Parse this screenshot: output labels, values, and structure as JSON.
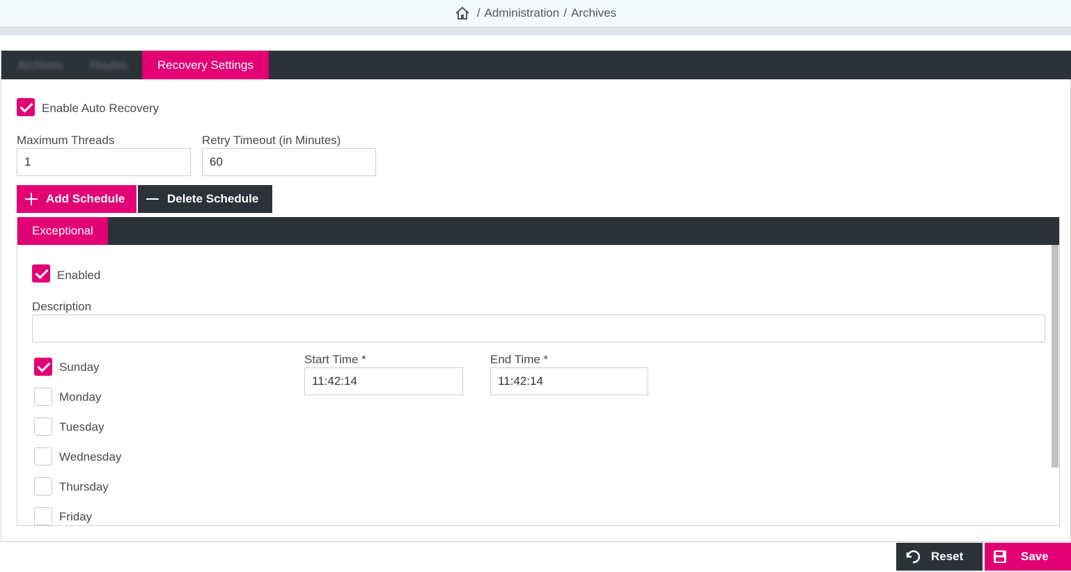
{
  "breadcrumb": {
    "part1": "Administration",
    "part2": "Archives",
    "separator": "/"
  },
  "tabs": [
    {
      "label": "Archives"
    },
    {
      "label": "Routes"
    },
    {
      "label": "Recovery Settings"
    }
  ],
  "recovery": {
    "enable_label": "Enable Auto Recovery",
    "enabled": true,
    "max_threads_label": "Maximum Threads",
    "max_threads_value": "1",
    "retry_timeout_label": "Retry Timeout (in Minutes)",
    "retry_timeout_value": "60"
  },
  "actions": {
    "add_schedule": "Add Schedule",
    "delete_schedule": "Delete Schedule"
  },
  "schedule": {
    "tab_label": "Exceptional",
    "enabled_label": "Enabled",
    "enabled": true,
    "description_label": "Description",
    "description_value": "",
    "days": [
      {
        "label": "Sunday",
        "checked": true
      },
      {
        "label": "Monday",
        "checked": false
      },
      {
        "label": "Tuesday",
        "checked": false
      },
      {
        "label": "Wednesday",
        "checked": false
      },
      {
        "label": "Thursday",
        "checked": false
      },
      {
        "label": "Friday",
        "checked": false
      }
    ],
    "start_time_label": "Start Time *",
    "start_time_value": "11:42:14",
    "end_time_label": "End Time *",
    "end_time_value": "11:42:14"
  },
  "footer": {
    "reset": "Reset",
    "save": "Save"
  },
  "colors": {
    "accent": "#e20074",
    "dark": "#2c3239"
  }
}
